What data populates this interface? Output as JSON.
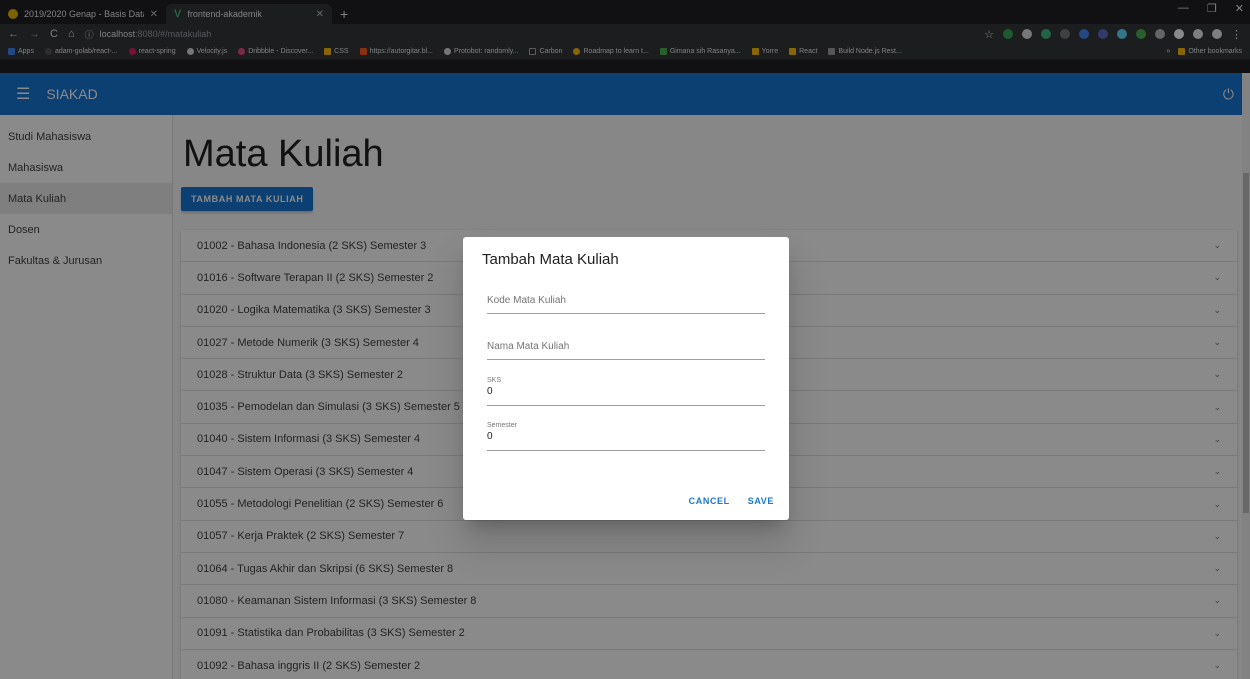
{
  "browser": {
    "tabs": [
      {
        "title": "2019/2020 Genap - Basis Data 2",
        "color": "#e8b800"
      },
      {
        "title": "frontend-akademik",
        "color": "#41b883"
      }
    ],
    "new_tab": "+",
    "url_host": "localhost",
    "url_path": ":8080/#/matakuliah",
    "bookmarks": [
      {
        "label": "Apps",
        "color": "#fbbc04"
      },
      {
        "label": "adam-golab/react-...",
        "color": "#555"
      },
      {
        "label": "react-spring",
        "color": "#e91e63"
      },
      {
        "label": "Velocity.js",
        "color": "#ddd"
      },
      {
        "label": "Dribbble - Discover...",
        "color": "#ea4c89"
      },
      {
        "label": "CSS",
        "color": "#fbbc04"
      },
      {
        "label": "https://autorgitar.bl...",
        "color": "#ff5722"
      },
      {
        "label": "Protobot: randomly...",
        "color": "#ddd"
      },
      {
        "label": "Carbon",
        "color": "#333"
      },
      {
        "label": "Roadmap to learn t...",
        "color": "#fbbc04"
      },
      {
        "label": "Gimana sih Rasanya...",
        "color": "#4caf50"
      },
      {
        "label": "Yorre",
        "color": "#fbbc04"
      },
      {
        "label": "React",
        "color": "#fbbc04"
      },
      {
        "label": "Build Node.js Rest...",
        "color": "#9e9e9e"
      }
    ],
    "bookmarks_more": "»",
    "other_bookmarks": "Other bookmarks"
  },
  "app": {
    "brand": "SIAKAD",
    "accent": "#1976d2",
    "nav": [
      {
        "label": "Studi Mahasiswa"
      },
      {
        "label": "Mahasiswa"
      },
      {
        "label": "Mata Kuliah"
      },
      {
        "label": "Dosen"
      },
      {
        "label": "Fakultas & Jurusan"
      }
    ],
    "active_nav": "Mata Kuliah",
    "page_title": "Mata Kuliah",
    "add_button": "TAMBAH MATA KULIAH",
    "courses": [
      "01002 - Bahasa Indonesia (2 SKS) Semester 3",
      "01016 - Software Terapan II (2 SKS) Semester 2",
      "01020 - Logika Matematika (3 SKS) Semester 3",
      "01027 - Metode Numerik (3 SKS) Semester 4",
      "01028 - Struktur Data (3 SKS) Semester 2",
      "01035 - Pemodelan dan Simulasi (3 SKS) Semester 5",
      "01040 - Sistem Informasi (3 SKS) Semester 4",
      "01047 - Sistem Operasi (3 SKS) Semester 4",
      "01055 - Metodologi Penelitian (2 SKS) Semester 6",
      "01057 - Kerja Praktek (2 SKS) Semester 7",
      "01064 - Tugas Akhir dan Skripsi (6 SKS) Semester 8",
      "01080 - Keamanan Sistem Informasi (3 SKS) Semester 8",
      "01091 - Statistika dan Probabilitas (3 SKS) Semester 2",
      "01092 - Bahasa inggris II (2 SKS) Semester 2"
    ]
  },
  "dialog": {
    "title": "Tambah Mata Kuliah",
    "kode_placeholder": "Kode Mata Kuliah",
    "nama_placeholder": "Nama Mata Kuliah",
    "sks_label": "SKS",
    "sks_value": "0",
    "semester_label": "Semester",
    "semester_value": "0",
    "cancel": "CANCEL",
    "save": "SAVE"
  }
}
